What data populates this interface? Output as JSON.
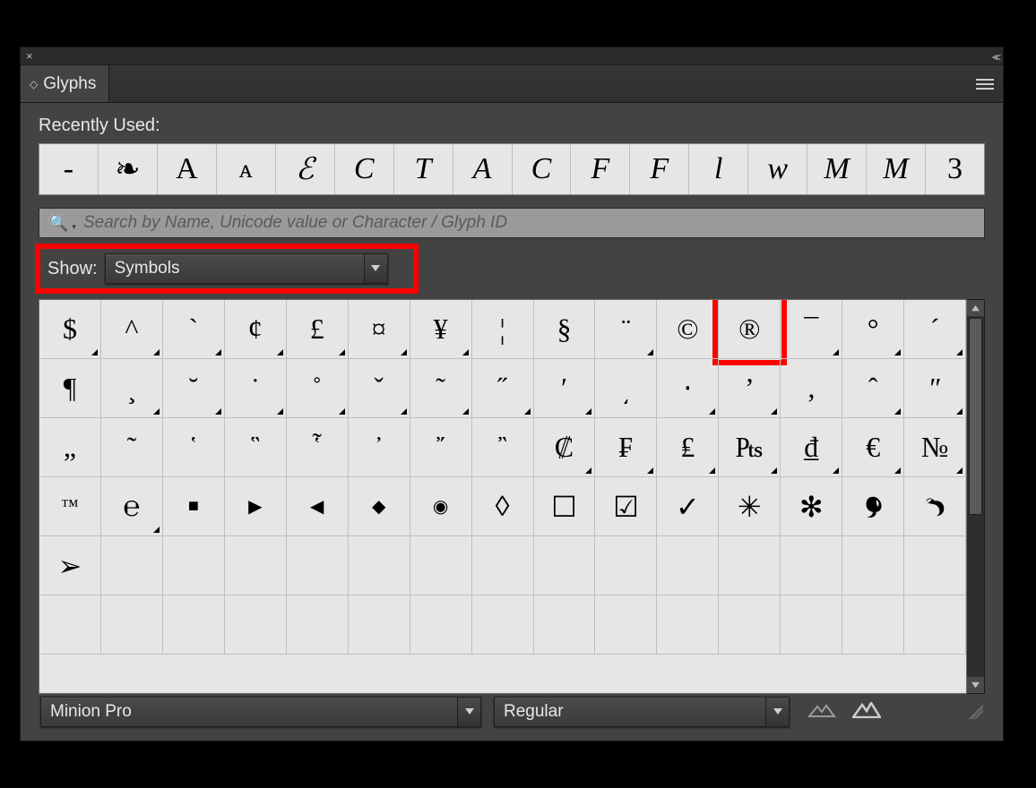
{
  "panel": {
    "title": "Glyphs",
    "recent_label": "Recently Used:",
    "search_placeholder": "Search by Name, Unicode value or Character / Glyph ID",
    "show_label": "Show:",
    "show_value": "Symbols",
    "font_family": "Minion Pro",
    "font_style": "Regular"
  },
  "recent": [
    {
      "g": "-",
      "cls": ""
    },
    {
      "g": "❧",
      "cls": ""
    },
    {
      "g": "A",
      "cls": ""
    },
    {
      "g": "ᴀ",
      "cls": "smallcap"
    },
    {
      "g": "ℰ",
      "cls": "script"
    },
    {
      "g": "C",
      "cls": "script"
    },
    {
      "g": "T",
      "cls": "script"
    },
    {
      "g": "A",
      "cls": "script"
    },
    {
      "g": "C",
      "cls": "italic"
    },
    {
      "g": "F",
      "cls": "script"
    },
    {
      "g": "F",
      "cls": "italic"
    },
    {
      "g": "l",
      "cls": "italic"
    },
    {
      "g": "w",
      "cls": "italic"
    },
    {
      "g": "M",
      "cls": "script"
    },
    {
      "g": "M",
      "cls": "italic"
    },
    {
      "g": "3",
      "cls": ""
    }
  ],
  "grid": [
    [
      {
        "g": "$",
        "alt": true
      },
      {
        "g": "^",
        "alt": true
      },
      {
        "g": "`",
        "alt": true
      },
      {
        "g": "¢",
        "alt": true
      },
      {
        "g": "£",
        "alt": true
      },
      {
        "g": "¤",
        "alt": true
      },
      {
        "g": "¥",
        "alt": true
      },
      {
        "g": "¦",
        "alt": false
      },
      {
        "g": "§",
        "alt": false
      },
      {
        "g": "¨",
        "alt": true
      },
      {
        "g": "©",
        "alt": false
      },
      {
        "g": "®",
        "alt": false,
        "hl": true
      },
      {
        "g": "¯",
        "alt": true
      },
      {
        "g": "°",
        "alt": true
      },
      {
        "g": "´",
        "alt": true
      }
    ],
    [
      {
        "g": "¶",
        "alt": false
      },
      {
        "g": "¸",
        "alt": true
      },
      {
        "g": "˘",
        "alt": true
      },
      {
        "g": "˙",
        "alt": true
      },
      {
        "g": "˚",
        "alt": true
      },
      {
        "g": "ˇ",
        "alt": true
      },
      {
        "g": "˜",
        "alt": true
      },
      {
        "g": "˝",
        "alt": true
      },
      {
        "g": "ʹ",
        "alt": true
      },
      {
        "g": "͵",
        "alt": false
      },
      {
        "g": "‧",
        "alt": true
      },
      {
        "g": "ʼ",
        "alt": true
      },
      {
        "g": "‚",
        "alt": false
      },
      {
        "g": "ˆ",
        "alt": true
      },
      {
        "g": "ʺ",
        "alt": true
      }
    ],
    [
      {
        "g": "„",
        "alt": false
      },
      {
        "g": "῀",
        "alt": false
      },
      {
        "g": "῾",
        "alt": false
      },
      {
        "g": "῝",
        "alt": false
      },
      {
        "g": "῟",
        "alt": false
      },
      {
        "g": "᾿",
        "alt": false
      },
      {
        "g": "῎",
        "alt": false
      },
      {
        "g": "῍",
        "alt": false
      },
      {
        "g": "₡",
        "alt": true
      },
      {
        "g": "₣",
        "alt": true
      },
      {
        "g": "₤",
        "alt": true
      },
      {
        "g": "₧",
        "alt": true
      },
      {
        "g": "₫",
        "alt": true
      },
      {
        "g": "€",
        "alt": true
      },
      {
        "g": "№",
        "alt": true
      }
    ],
    [
      {
        "g": "™",
        "alt": false,
        "cls": "sm"
      },
      {
        "g": "℮",
        "alt": true
      },
      {
        "g": "■",
        "alt": false,
        "cls": "sm"
      },
      {
        "g": "▶",
        "alt": false,
        "cls": "sm"
      },
      {
        "g": "◀",
        "alt": false,
        "cls": "sm"
      },
      {
        "g": "◆",
        "alt": false,
        "cls": "sm"
      },
      {
        "g": "◉",
        "alt": false,
        "cls": "sm"
      },
      {
        "g": "◊",
        "alt": false
      },
      {
        "g": "☐",
        "alt": false
      },
      {
        "g": "☑",
        "alt": false
      },
      {
        "g": "✓",
        "alt": false
      },
      {
        "g": "✳",
        "alt": false
      },
      {
        "g": "✻",
        "alt": false
      },
      {
        "g": "❦",
        "alt": false,
        "svg": "fleuron1"
      },
      {
        "g": "❧",
        "alt": false,
        "svg": "fleuron2"
      }
    ],
    [
      {
        "g": "➢",
        "alt": false
      },
      {
        "g": ""
      },
      {
        "g": ""
      },
      {
        "g": ""
      },
      {
        "g": ""
      },
      {
        "g": ""
      },
      {
        "g": ""
      },
      {
        "g": ""
      },
      {
        "g": ""
      },
      {
        "g": ""
      },
      {
        "g": ""
      },
      {
        "g": ""
      },
      {
        "g": ""
      },
      {
        "g": ""
      },
      {
        "g": ""
      }
    ],
    [
      {
        "g": ""
      },
      {
        "g": ""
      },
      {
        "g": ""
      },
      {
        "g": ""
      },
      {
        "g": ""
      },
      {
        "g": ""
      },
      {
        "g": ""
      },
      {
        "g": ""
      },
      {
        "g": ""
      },
      {
        "g": ""
      },
      {
        "g": ""
      },
      {
        "g": ""
      },
      {
        "g": ""
      },
      {
        "g": ""
      },
      {
        "g": ""
      }
    ]
  ],
  "highlight_cell": {
    "row": 0,
    "col": 11
  }
}
